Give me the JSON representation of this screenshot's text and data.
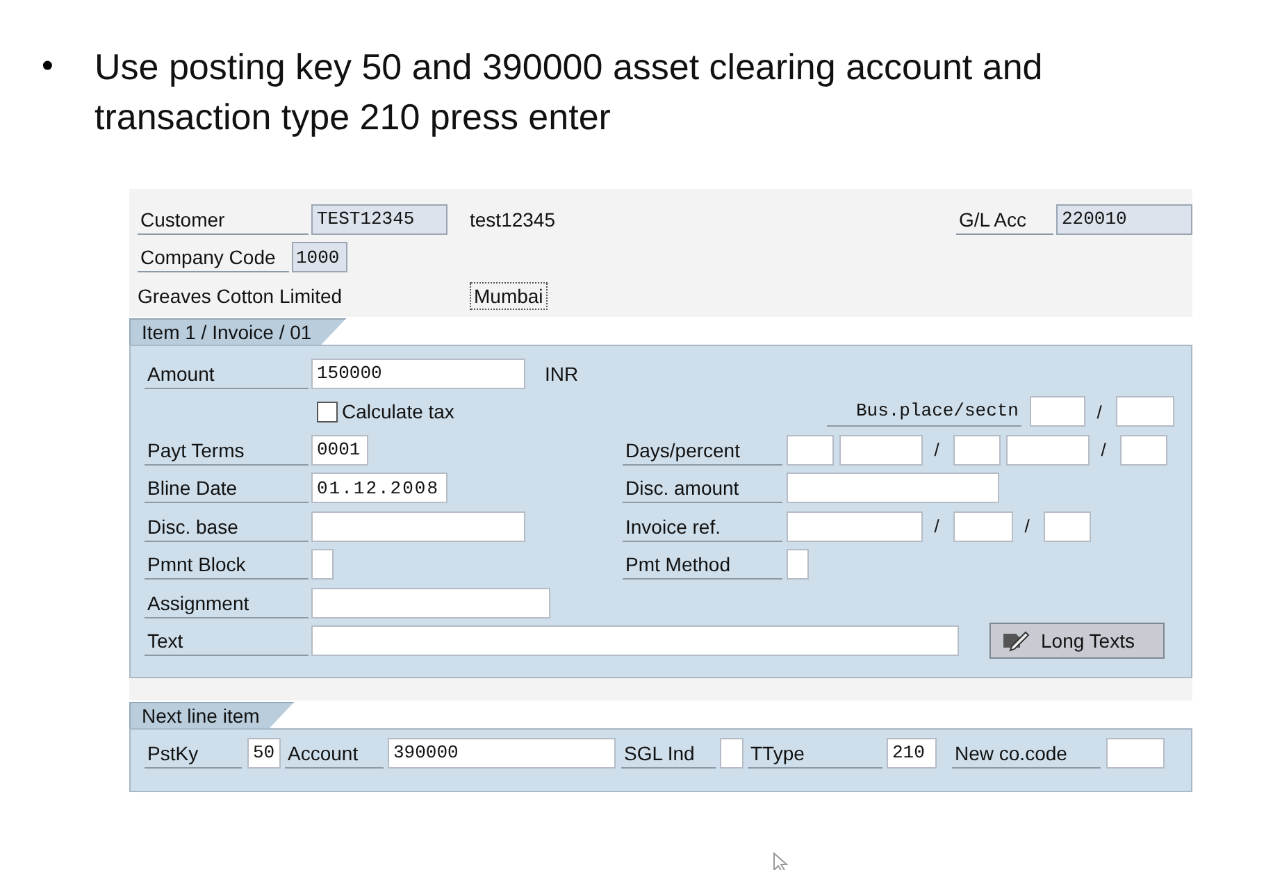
{
  "instruction": {
    "bullet": "•",
    "text": "Use posting key 50 and 390000 asset clearing account and transaction type 210 press enter"
  },
  "header": {
    "customer": {
      "label": "Customer",
      "value": "TEST12345",
      "name": "test12345"
    },
    "gl_account": {
      "label": "G/L Acc",
      "value": "220010"
    },
    "company_code": {
      "label": "Company Code",
      "value": "1000"
    },
    "company_name": "Greaves Cotton Limited",
    "city": "Mumbai"
  },
  "item": {
    "tab": "Item 1 / Invoice / 01",
    "amount": {
      "label": "Amount",
      "value": "150000",
      "currency": "INR"
    },
    "calculate_tax": {
      "label": "Calculate tax",
      "checked": false
    },
    "bus_place": {
      "label": "Bus.place/sectn",
      "separator": "/"
    },
    "payt_terms": {
      "label": "Payt Terms",
      "value": "0001"
    },
    "days_percent": {
      "label": "Days/percent",
      "separators": [
        "/",
        "/"
      ]
    },
    "bline_date": {
      "label": "Bline Date",
      "value": "01.12.2008"
    },
    "disc_amount": {
      "label": "Disc. amount"
    },
    "disc_base": {
      "label": "Disc. base"
    },
    "invoice_ref": {
      "label": "Invoice ref.",
      "separators": [
        "/",
        "/"
      ]
    },
    "pmnt_block": {
      "label": "Pmnt Block"
    },
    "pmt_method": {
      "label": "Pmt Method"
    },
    "assignment": {
      "label": "Assignment"
    },
    "text": {
      "label": "Text"
    },
    "long_texts_button": "Long Texts"
  },
  "next_line_item": {
    "tab": "Next line item",
    "posting_key": {
      "label": "PstKy",
      "value": "50"
    },
    "account": {
      "label": "Account",
      "value": "390000"
    },
    "sgl_ind": {
      "label": "SGL Ind"
    },
    "ttype": {
      "label": "TType",
      "value": "210"
    },
    "new_co_code": {
      "label": "New co.code"
    }
  }
}
